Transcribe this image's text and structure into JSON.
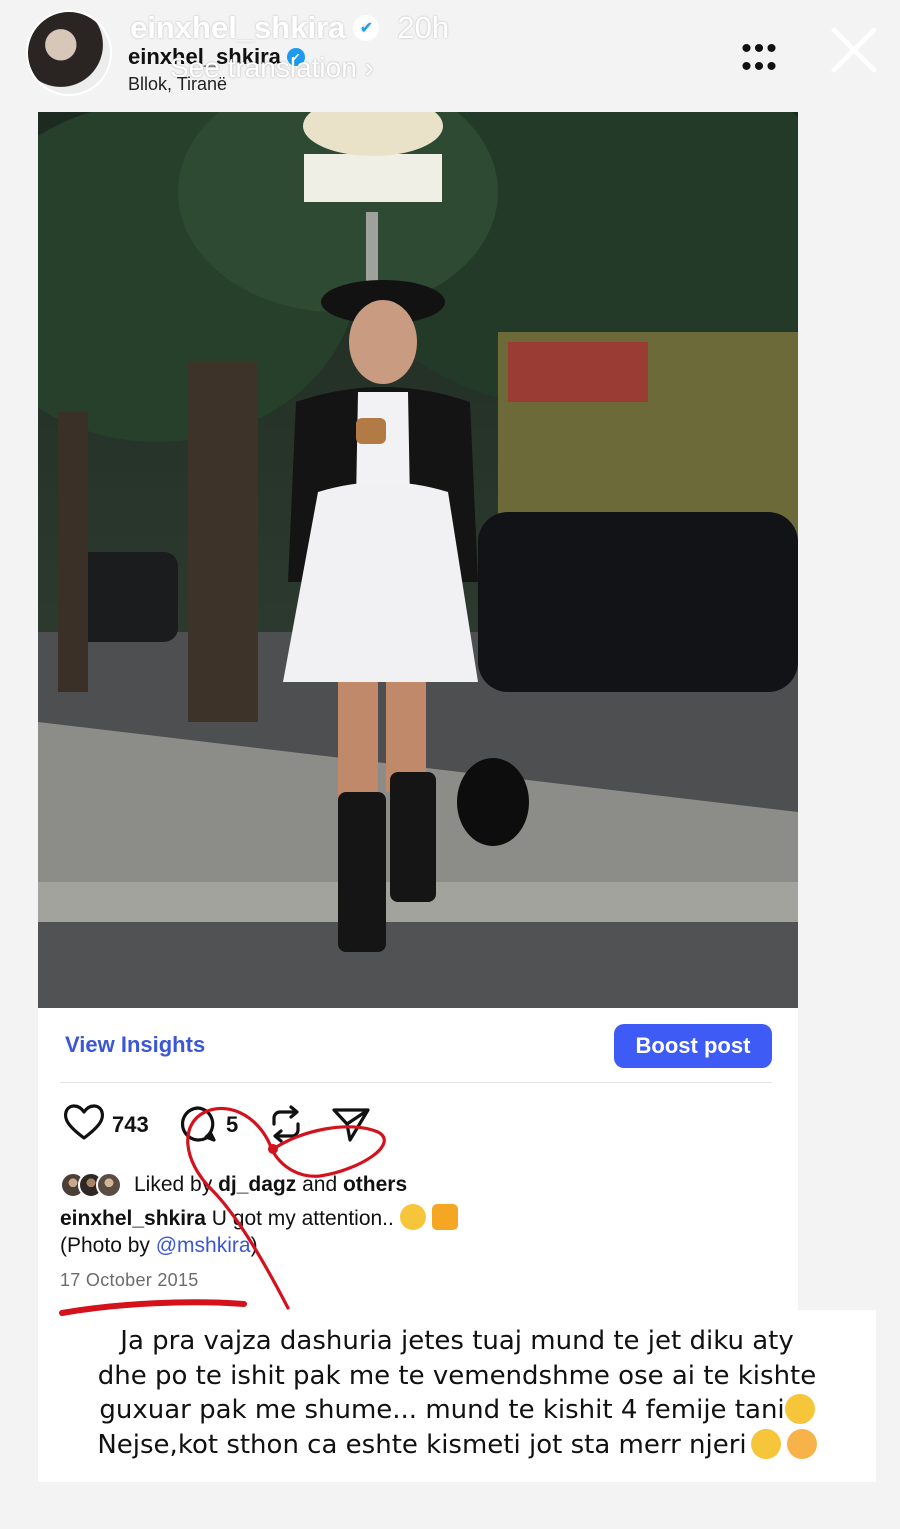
{
  "story": {
    "username": "einxhel_shkira",
    "time_ago": "20h",
    "see_translation": "See translation",
    "icons": {
      "more": "more-dots-icon",
      "close": "close-icon"
    }
  },
  "post": {
    "username": "einxhel_shkira",
    "location": "Bllok, Tiranë",
    "actions": {
      "view_insights": "View Insights",
      "boost_post": "Boost post"
    },
    "likes_count": "743",
    "comments_count": "5",
    "liked_by_prefix": "Liked by",
    "liked_by_user": "dj_dagz",
    "liked_by_and": "and",
    "liked_by_others": "others",
    "caption_user": "einxhel_shkira",
    "caption_text": "U got my attention..",
    "photo_credit_prefix": "(Photo by",
    "photo_credit_mention": "@mshkira",
    "photo_credit_suffix": ")",
    "date": "17 October 2015",
    "icons": [
      "heart-icon",
      "comment-icon",
      "repost-icon",
      "share-icon"
    ]
  },
  "story_text": {
    "line1": "Ja pra vajza dashuria jetes tuaj mund te jet diku aty",
    "line2": "dhe po te ishit pak me te vemendshme ose ai te kishte",
    "line3": "guxuar pak me shume... mund te kishit 4 femije tani",
    "line4": "Nejse,kot sthon ca eshte kismeti jot sta merr njeri"
  },
  "colors": {
    "accent_blue": "#3e5cf5",
    "link_blue": "#3b57d6",
    "scribble_red": "#d3121c"
  }
}
